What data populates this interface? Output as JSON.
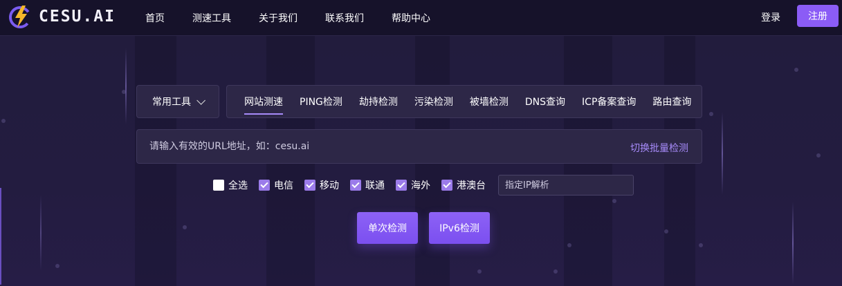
{
  "brand": {
    "name": "CESU.AI",
    "accent": "#8b5cf6",
    "logo_color": "#f5b72a"
  },
  "nav": {
    "items": [
      "首页",
      "测速工具",
      "关于我们",
      "联系我们",
      "帮助中心"
    ]
  },
  "auth": {
    "login": "登录",
    "register": "注册"
  },
  "tools": {
    "select_label": "常用工具"
  },
  "tabs": {
    "items": [
      "网站测速",
      "PING检测",
      "劫持检测",
      "污染检测",
      "被墙检测",
      "DNS查询",
      "ICP备案查询",
      "路由查询"
    ],
    "active": "网站测速"
  },
  "url": {
    "placeholder": "请输入有效的URL地址，如：cesu.ai",
    "value": "",
    "batch_label": "切换批量检测"
  },
  "isps": [
    {
      "label": "全选",
      "checked": false
    },
    {
      "label": "电信",
      "checked": true
    },
    {
      "label": "移动",
      "checked": true
    },
    {
      "label": "联通",
      "checked": true
    },
    {
      "label": "海外",
      "checked": true
    },
    {
      "label": "港澳台",
      "checked": true
    }
  ],
  "ip": {
    "placeholder": "指定IP解析",
    "value": ""
  },
  "actions": {
    "single": "单次检测",
    "ipv6": "IPv6检测"
  }
}
